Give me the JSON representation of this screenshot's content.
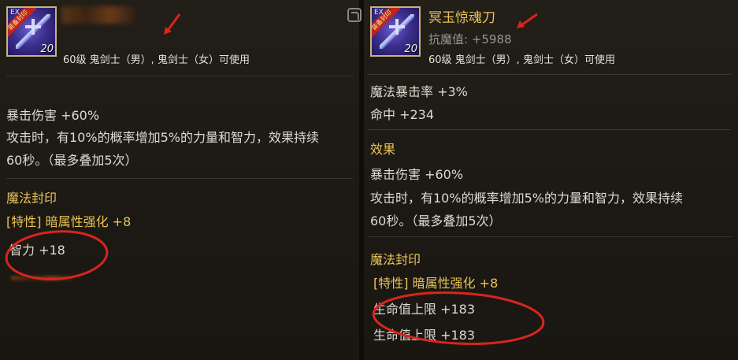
{
  "left": {
    "item": {
      "icon_tag": "EX",
      "ribbon": "装备封印",
      "level_badge": "20",
      "requirement": "60级 鬼剑士（男）, 鬼剑士（女）可使用"
    },
    "effects": {
      "crit_damage": "暴击伤害 +60%",
      "proc_line1": "攻击时，有10%的概率增加5%的力量和智力，效果持续",
      "proc_line2": "60秒。（最多叠加5次）"
    },
    "seal": {
      "header": "魔法封印",
      "trait": "[特性] 暗属性强化 +8",
      "stat": "智力 +18"
    }
  },
  "right": {
    "item": {
      "icon_tag": "EX",
      "ribbon": "装备封印",
      "level_badge": "20",
      "name": "冥玉惊魂刀",
      "magic_resist": "抗魔值: +5988",
      "requirement": "60级 鬼剑士（男）, 鬼剑士（女）可使用"
    },
    "stats": {
      "magic_crit": "魔法暴击率 +3%",
      "hit": "命中 +234"
    },
    "effects": {
      "header": "效果",
      "crit_damage": "暴击伤害 +60%",
      "proc_line1": "攻击时，有10%的概率增加5%的力量和智力，效果持续",
      "proc_line2": "60秒。（最多叠加5次）"
    },
    "seal": {
      "header": "魔法封印",
      "trait": "[特性] 暗属性强化 +8",
      "stat1": "生命值上限 +183",
      "stat2": "生命值上限 +183"
    }
  },
  "colors": {
    "gold": "#e9c356",
    "annotation_red": "#d8251c",
    "text": "#dedad0"
  },
  "icons": [
    "weapon-blade-icon",
    "swap-compare-icon"
  ]
}
